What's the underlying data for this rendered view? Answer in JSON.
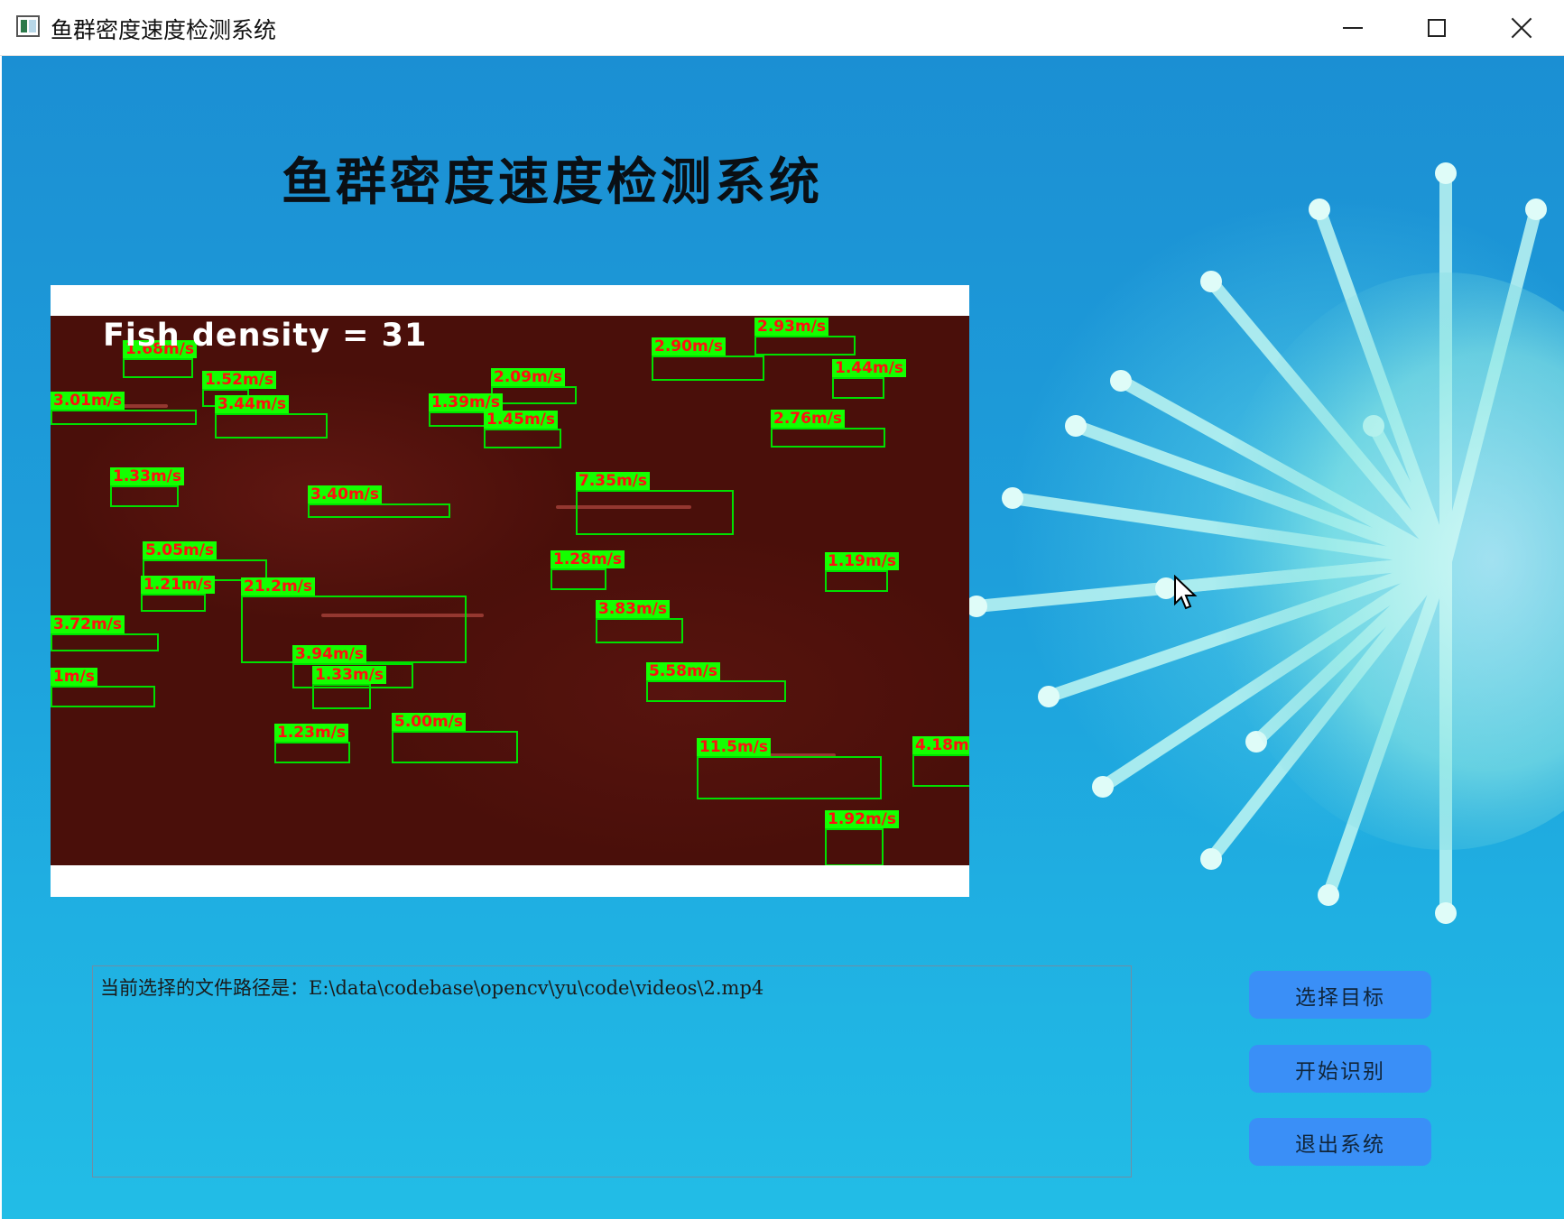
{
  "window": {
    "title": "鱼群密度速度检测系统"
  },
  "page": {
    "title": "鱼群密度速度检测系统"
  },
  "video": {
    "density_text": "Fish density = 31",
    "detections": [
      "1.68m/s",
      "3.01m/s",
      "1.52m/s",
      "3.44m/s",
      "2.09m/s",
      "1.39m/s",
      "1.45m/s",
      "2.90m/s",
      "2.93m/s",
      "1.44m/s",
      "2.76m/s",
      "1.33m/s",
      "3.40m/s",
      "7.35m/s",
      "5.05m/s",
      "1.28m/s",
      "1.19m/s",
      "1.21m/s",
      "21.2m/s",
      "3.83m/s",
      "3.72m/s",
      "3.94m/s",
      "1m/s",
      "1.33m/s",
      "5.58m/s",
      "5.00m/s",
      "1.23m/s",
      "11.5m/s",
      "4.18m",
      "1.92m/s"
    ]
  },
  "path": {
    "text": "当前选择的文件路径是：E:\\data\\codebase\\opencv\\yu\\code\\videos\\2.mp4"
  },
  "buttons": {
    "select": "选择目标",
    "start": "开始识别",
    "exit": "退出系统"
  },
  "colors": {
    "button_bg": "#3a8ff7",
    "box_green": "#00e000",
    "label_green": "#14ff00",
    "label_text_red": "#ff1010"
  }
}
